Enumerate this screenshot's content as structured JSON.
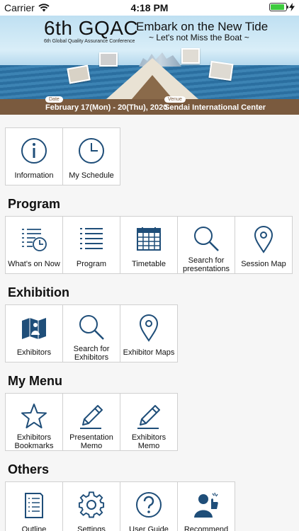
{
  "status_bar": {
    "carrier": "Carrier",
    "time": "4:18 PM",
    "battery_level": 0.9
  },
  "banner": {
    "title": "6th GQAC",
    "subtitle": "6th Global Quality Assurance Conference",
    "tagline": "Embark on the New Tide",
    "tagline2": "~ Let's not Miss the Boat ~",
    "date_label": "Date",
    "date": "February 17(Mon) - 20(Thu), 2020",
    "venue_label": "Venue",
    "venue": "Sendai International Center"
  },
  "top_items": [
    {
      "label": "Information",
      "icon": "info-icon"
    },
    {
      "label": "My Schedule",
      "icon": "clock-icon"
    }
  ],
  "sections": {
    "program": {
      "title": "Program",
      "items": [
        {
          "label": "What's on Now",
          "icon": "list-clock-icon"
        },
        {
          "label": "Program",
          "icon": "list-icon"
        },
        {
          "label": "Timetable",
          "icon": "calendar-grid-icon"
        },
        {
          "label": "Search for presentations",
          "icon": "search-icon"
        },
        {
          "label": "Session Map",
          "icon": "map-pin-icon"
        }
      ]
    },
    "exhibition": {
      "title": "Exhibition",
      "items": [
        {
          "label": "Exhibitors",
          "icon": "exhibitor-map-icon"
        },
        {
          "label": "Search for Exhibitors",
          "icon": "search-icon"
        },
        {
          "label": "Exhibitor Maps",
          "icon": "map-pin-icon"
        }
      ]
    },
    "my_menu": {
      "title": "My Menu",
      "items": [
        {
          "label": "Exhibitors Bookmarks",
          "icon": "star-icon"
        },
        {
          "label": "Presentation Memo",
          "icon": "pencil-icon"
        },
        {
          "label": "Exhibitors Memo",
          "icon": "pencil-icon"
        }
      ]
    },
    "others": {
      "title": "Others",
      "items": [
        {
          "label": "Outline",
          "icon": "document-icon"
        },
        {
          "label": "Settings",
          "icon": "gear-icon"
        },
        {
          "label": "User Guide",
          "icon": "question-icon"
        },
        {
          "label": "Recommend",
          "icon": "recommend-person-icon"
        }
      ]
    }
  },
  "colors": {
    "icon": "#1f4e79",
    "background": "#f6f6f6",
    "banner_bar": "#7a5a3e"
  }
}
